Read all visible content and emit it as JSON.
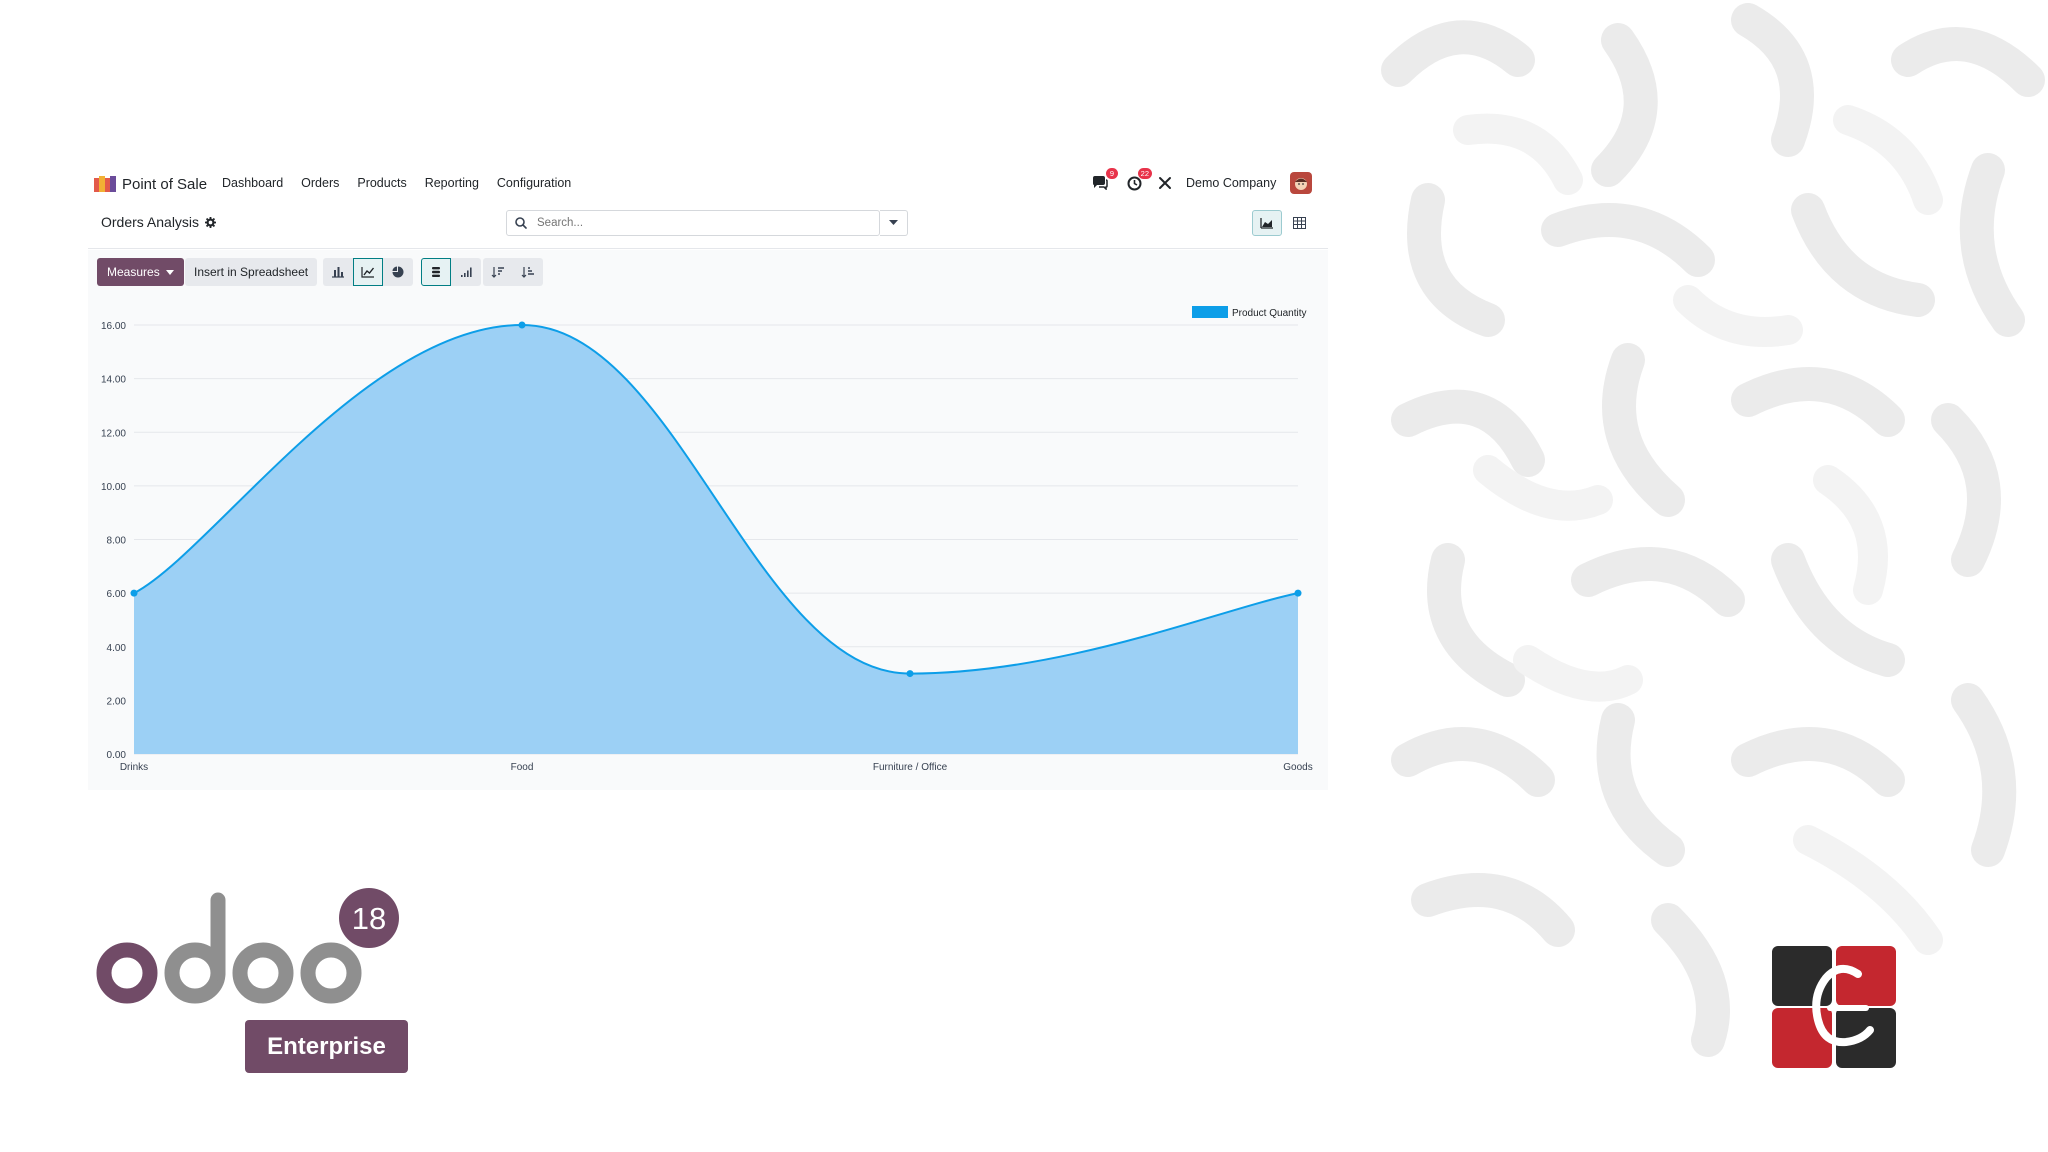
{
  "navbar": {
    "app_name": "Point of Sale",
    "menu": [
      "Dashboard",
      "Orders",
      "Products",
      "Reporting",
      "Configuration"
    ],
    "messages_count": "9",
    "activities_count": "22",
    "company": "Demo Company"
  },
  "control_panel": {
    "title": "Orders Analysis",
    "search_placeholder": "Search..."
  },
  "toolbar": {
    "measures_label": "Measures",
    "insert_label": "Insert in Spreadsheet"
  },
  "chart_data": {
    "type": "area",
    "categories": [
      "Drinks",
      "Food",
      "Furniture / Office",
      "Goods"
    ],
    "series": [
      {
        "name": "Product Quantity",
        "values": [
          6,
          16,
          3,
          6
        ],
        "color": "#0d9ee8"
      }
    ],
    "y_ticks": [
      "0.00",
      "2.00",
      "4.00",
      "6.00",
      "8.00",
      "10.00",
      "12.00",
      "14.00",
      "16.00"
    ],
    "ylim": [
      0,
      16
    ],
    "grid": true,
    "legend_position": "top-right"
  },
  "branding": {
    "logo_text": "odoo",
    "version": "18",
    "edition": "Enterprise"
  },
  "colors": {
    "brand": "#714b67",
    "accent": "#017e84",
    "series_fill": "#9cd0f5",
    "series_line": "#0d9ee8"
  }
}
